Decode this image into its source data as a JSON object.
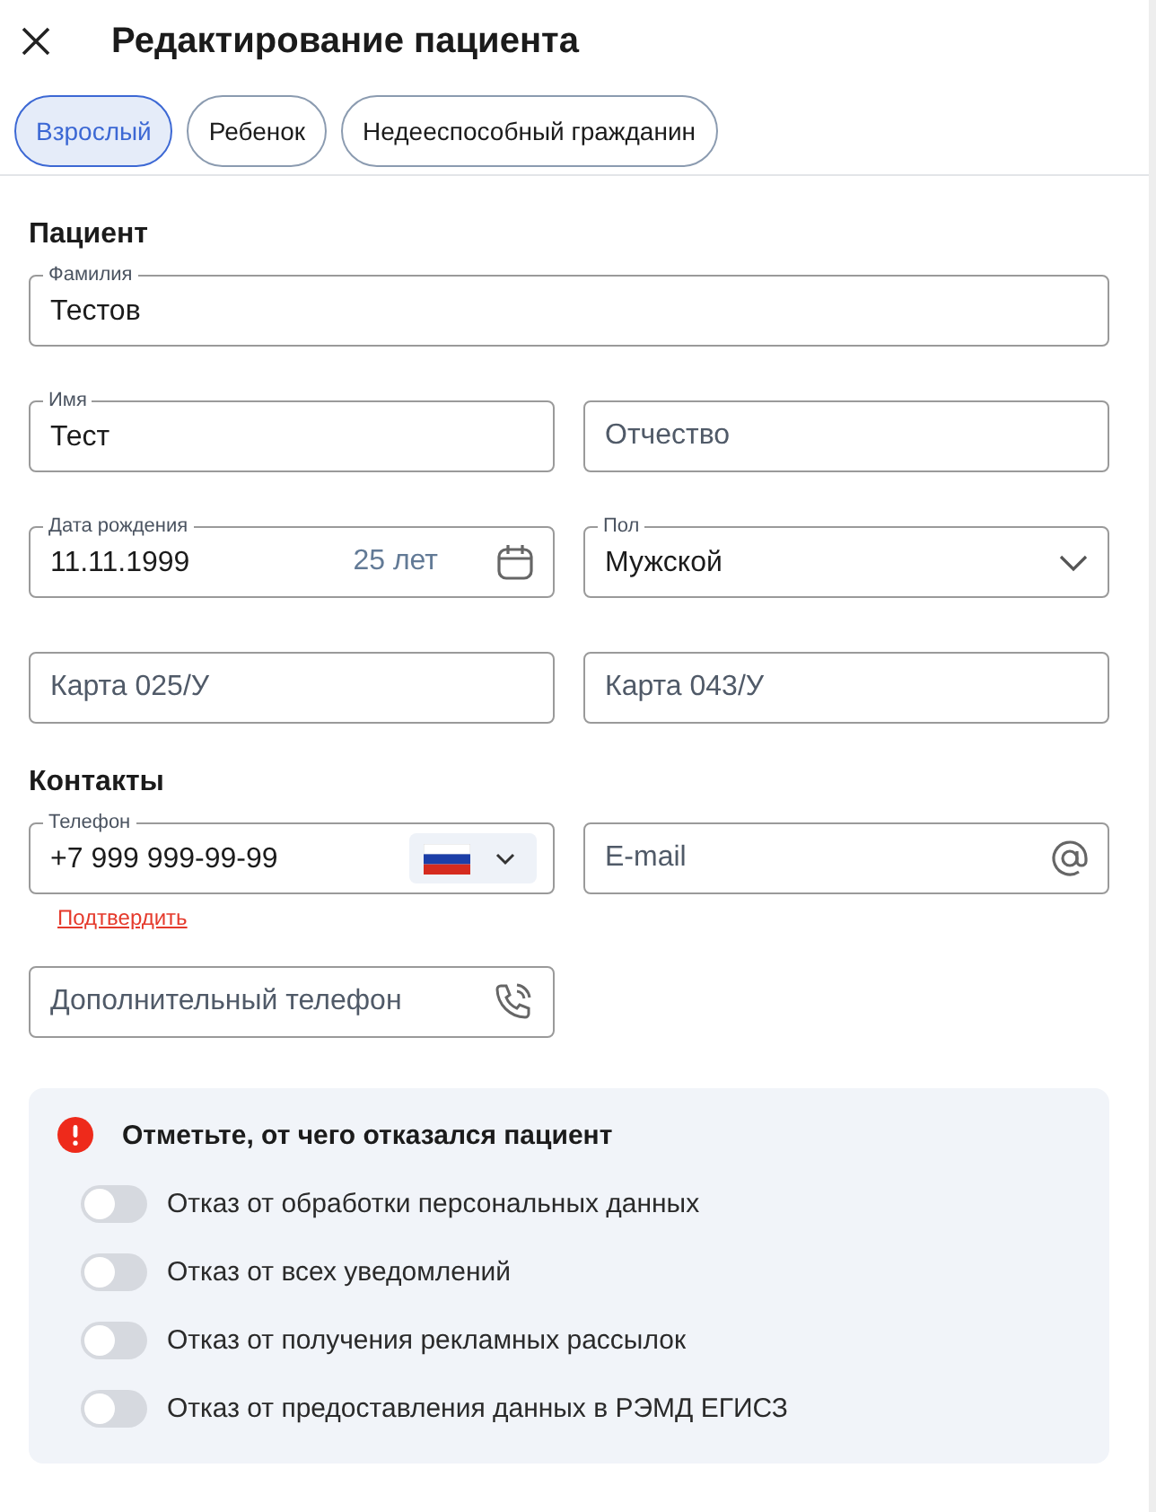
{
  "header": {
    "title": "Редактирование пациента"
  },
  "tabs": [
    {
      "label": "Взрослый",
      "selected": true
    },
    {
      "label": "Ребенок",
      "selected": false
    },
    {
      "label": "Недееспособный гражданин",
      "selected": false
    }
  ],
  "sections": [
    {
      "title": "Пациент",
      "rows": [
        [
          {
            "kind": "text",
            "label": "Фамилия",
            "value": "Тестов"
          }
        ],
        [
          {
            "kind": "text",
            "label": "Имя",
            "value": "Тест"
          },
          {
            "kind": "text",
            "placeholder": "Отчество"
          }
        ],
        [
          {
            "kind": "date",
            "label": "Дата рождения",
            "value": "11.11.1999",
            "suffix": "25 лет"
          },
          {
            "kind": "select",
            "label": "Пол",
            "value": "Мужской"
          }
        ],
        [
          {
            "kind": "text",
            "placeholder": "Карта 025/У"
          },
          {
            "kind": "text",
            "placeholder": "Карта 043/У"
          }
        ]
      ]
    },
    {
      "title": "Контакты",
      "rows": [
        [
          {
            "kind": "phone",
            "label": "Телефон",
            "value": "+7 999 999-99-99",
            "link": "Подтвердить"
          },
          {
            "kind": "email",
            "placeholder": "E-mail"
          }
        ],
        [
          {
            "kind": "phone-extra",
            "placeholder": "Дополнительный телефон"
          }
        ]
      ]
    }
  ],
  "refusals": {
    "title": "Отметьте, от чего отказался пациент",
    "items": [
      {
        "label": "Отказ от обработки персональных данных",
        "on": false
      },
      {
        "label": "Отказ от всех уведомлений",
        "on": false
      },
      {
        "label": "Отказ от получения рекламных рассылок",
        "on": false
      },
      {
        "label": "Отказ от предоставления данных в РЭМД ЕГИСЗ",
        "on": false
      }
    ]
  }
}
